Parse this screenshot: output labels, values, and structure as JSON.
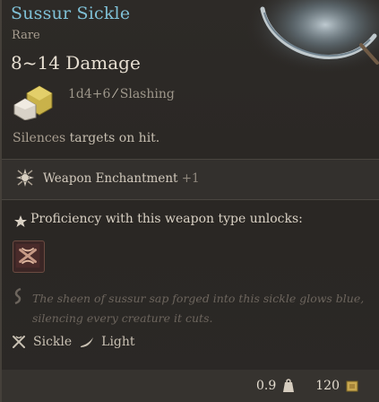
{
  "item": {
    "name": "Sussur Sickle",
    "rarity": "Rare",
    "damage": "8~14 Damage",
    "dice": "1d4+6",
    "damage_type": "Slashing",
    "effect_prefix": "Silences ",
    "effect_highlight": "targets on hit.",
    "enchantment_label": "Weapon Enchantment",
    "enchantment_bonus": "+1",
    "proficiency_text": "Proficiency with this weapon type unlocks:",
    "lore_text": "The sheen of sussur sap forged into this sickle glows blue, silencing every creature it cuts.",
    "tags": [
      {
        "label": "Sickle",
        "icon": "sickle-icon"
      },
      {
        "label": "Light",
        "icon": "light-weapon-icon"
      }
    ],
    "weight": "0.9",
    "value": "120"
  },
  "colors": {
    "name": "#7fc0d6",
    "rarity": "#a89e90",
    "background": "#2a2725"
  }
}
